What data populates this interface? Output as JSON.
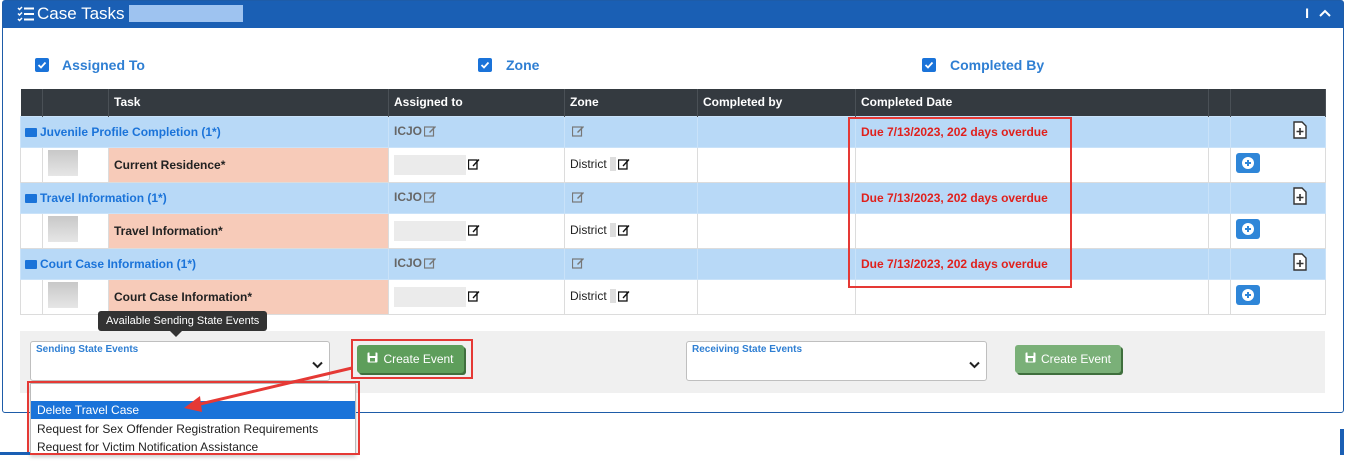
{
  "panel": {
    "title": "Case Tasks -"
  },
  "toggles": [
    {
      "label": "Assigned To"
    },
    {
      "label": "Zone"
    },
    {
      "label": "Completed By"
    }
  ],
  "table": {
    "headers": [
      "",
      "",
      "Task",
      "Assigned to",
      "Zone",
      "Completed by",
      "Completed Date",
      "",
      ""
    ],
    "groups": [
      {
        "title": "Juvenile Profile Completion (1*)",
        "assigned": "ICJO",
        "due": "Due 7/13/2023, 202 days overdue",
        "task": {
          "name": "Current Residence*",
          "zone": "District"
        }
      },
      {
        "title": "Travel Information (1*)",
        "assigned": "ICJO",
        "due": "Due 7/13/2023, 202 days overdue",
        "task": {
          "name": "Travel Information*",
          "zone": "District"
        }
      },
      {
        "title": "Court Case Information (1*)",
        "assigned": "ICJO",
        "due": "Due 7/13/2023, 202 days overdue",
        "task": {
          "name": "Court Case Information*",
          "zone": "District"
        }
      }
    ]
  },
  "events": {
    "tooltip": "Available Sending State Events",
    "sending_label": "Sending State Events",
    "receiving_label": "Receiving State Events",
    "create_label": "Create Event",
    "create_label_2": "Create Event",
    "options": [
      "Delete Travel Case",
      "Request for Sex Offender Registration Requirements",
      "Request for Victim Notification Assistance"
    ]
  },
  "colors": {
    "header": "#1a5fb4",
    "group_row": "#b8d9f7",
    "task_cell": "#f7cbb9",
    "overdue": "#e0201c",
    "highlight": "#e53935",
    "button": "#5e9e5b"
  }
}
